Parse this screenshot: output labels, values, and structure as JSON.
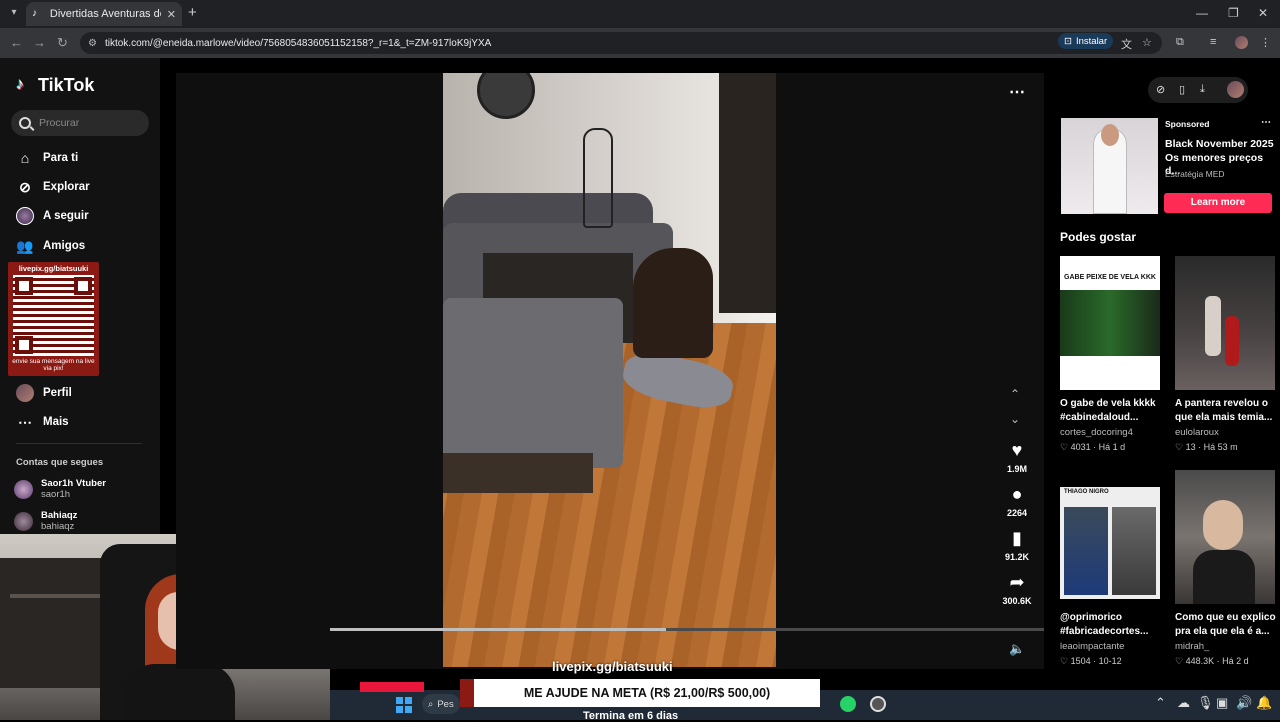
{
  "browser": {
    "tab_title": "Divertidas Aventuras de Perros d",
    "url": "tiktok.com/@eneida.marlowe/video/7568054836051152158?_r=1&_t=ZM-917loK9jYXA",
    "install_label": "Instalar"
  },
  "sidebar": {
    "logo": "TikTok",
    "search_placeholder": "Procurar",
    "items": [
      {
        "label": "Para ti",
        "icon": "home-icon"
      },
      {
        "label": "Explorar",
        "icon": "compass-icon"
      },
      {
        "label": "A seguir",
        "icon": "following-icon"
      },
      {
        "label": "Amigos",
        "icon": "friends-icon"
      },
      {
        "label": "Perfil",
        "icon": "profile-icon"
      },
      {
        "label": "Mais",
        "icon": "more-icon"
      }
    ],
    "following_title": "Contas que segues",
    "following": [
      {
        "name": "Saor1h Vtuber",
        "handle": "saor1h"
      },
      {
        "name": "Bahiaqz",
        "handle": "bahiaqz"
      }
    ]
  },
  "qr_overlay": {
    "top_text": "livepix.gg/biatsuuki",
    "bottom_text": "envie sua mensagem na live via pix!"
  },
  "video": {
    "progress": 0.47,
    "actions": {
      "likes": "1.9M",
      "comments": "2264",
      "saves": "91.2K",
      "shares": "300.6K"
    },
    "watermark": "livepix.gg/biatsuuki"
  },
  "ad": {
    "sponsored": "Sponsored",
    "title": "Black November 2025 Os menores preços d...",
    "brand": "Estratégia MED",
    "button": "Learn more"
  },
  "recommended": {
    "title": "Podes gostar",
    "items": [
      {
        "desc": "O gabe de vela kkkk #cabinedaloud...",
        "author": "cortes_docoring4",
        "likes": "4031",
        "age": "Há 1 d",
        "thumb_caption": "GABE PEIXE DE VELA KKK"
      },
      {
        "desc": "A pantera revelou o que ela mais temia...",
        "author": "eulolaroux",
        "likes": "13",
        "age": "Há 53 m",
        "thumb_caption": ""
      },
      {
        "desc": "@oprimorico #fabricadecortes...",
        "author": "leaoimpactante",
        "likes": "1504",
        "age": "10-12",
        "thumb_caption": "THIAGO NIGRO"
      },
      {
        "desc": "Como que eu explico pra ela que ela é a...",
        "author": "midrah_",
        "likes": "448.3K",
        "age": "Há 2 d",
        "thumb_caption": ""
      }
    ]
  },
  "stream": {
    "goal_text": "ME AJUDE NA META (R$ 21,00/R$ 500,00)",
    "goal_sub": "Termina em 6 dias"
  },
  "taskbar": {
    "search_text": "Pes"
  },
  "colors": {
    "accent": "#fe2c55",
    "goal_red": "#8b1a14"
  }
}
